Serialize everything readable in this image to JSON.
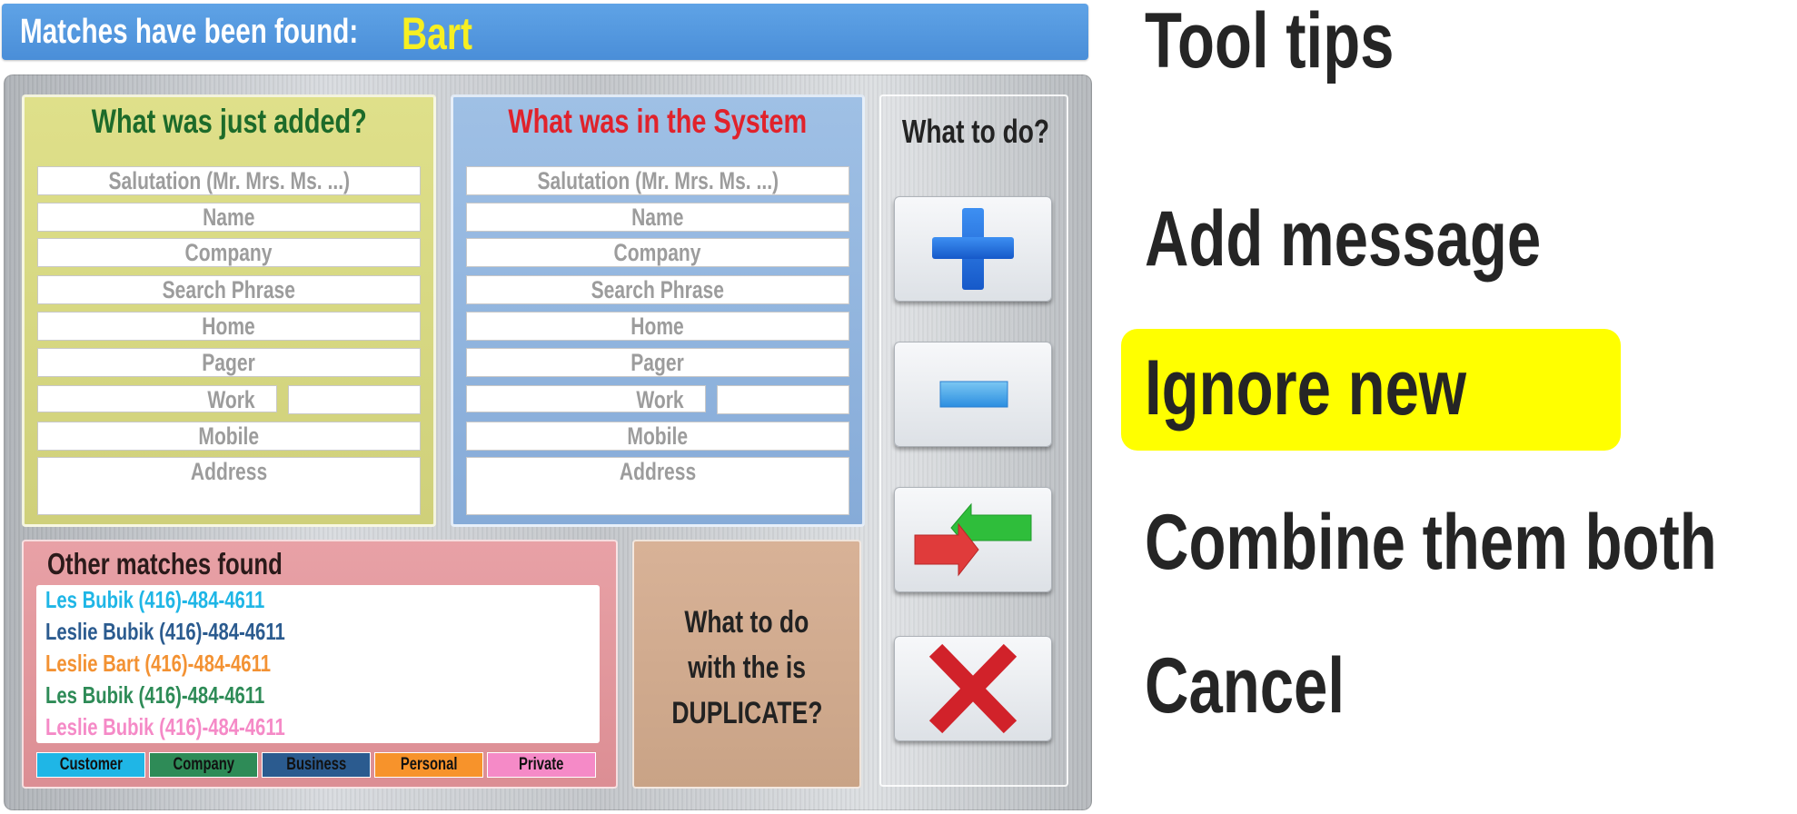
{
  "header": {
    "label": "Matches have been found:",
    "value": "Bart"
  },
  "new_panel": {
    "title": "What was just added?",
    "fields": {
      "salutation": "Salutation (Mr.  Mrs. Ms. ...)",
      "name": "Name",
      "company": "Company",
      "search_phrase": "Search Phrase",
      "home": "Home",
      "pager": "Pager",
      "work": "Work",
      "mobile": "Mobile",
      "address": "Address"
    }
  },
  "system_panel": {
    "title": "What was in the System",
    "fields": {
      "salutation": "Salutation (Mr.  Mrs. Ms. ...)",
      "name": "Name",
      "company": "Company",
      "search_phrase": "Search Phrase",
      "home": "Home",
      "pager": "Pager",
      "work": "Work",
      "mobile": "Mobile",
      "address": "Address"
    }
  },
  "actions": {
    "title": "What to do?",
    "buttons": [
      {
        "icon": "plus-icon"
      },
      {
        "icon": "minus-icon"
      },
      {
        "icon": "merge-arrows-icon"
      },
      {
        "icon": "x-icon"
      }
    ]
  },
  "other_matches": {
    "title": "Other matches found",
    "items": [
      {
        "text": "Les Bubik (416)-484-4611",
        "color": "#1fb6e6"
      },
      {
        "text": "Leslie Bubik (416)-484-4611",
        "color": "#2b5b8f"
      },
      {
        "text": "Leslie Bart (416)-484-4611",
        "color": "#f39233"
      },
      {
        "text": "Les Bubik (416)-484-4611",
        "color": "#2e8b57"
      },
      {
        "text": "Leslie Bubik (416)-484-4611",
        "color": "#f58ac7"
      }
    ],
    "legend": [
      {
        "label": "Customer",
        "color": "#1fb6e6"
      },
      {
        "label": "Company",
        "color": "#2e8b57"
      },
      {
        "label": "Business",
        "color": "#2b5b8f"
      },
      {
        "label": "Personal",
        "color": "#f7932b"
      },
      {
        "label": "Private",
        "color": "#f58ac7"
      }
    ]
  },
  "duplicate_note": {
    "line1": "What to do",
    "line2": "with the is",
    "line3": "DUPLICATE?"
  },
  "tool_tips": {
    "title": "Tool tips",
    "add": "Add message",
    "ignore": "Ignore new",
    "combine": "Combine them both",
    "cancel": "Cancel",
    "highlight_color": "#ffff00"
  }
}
